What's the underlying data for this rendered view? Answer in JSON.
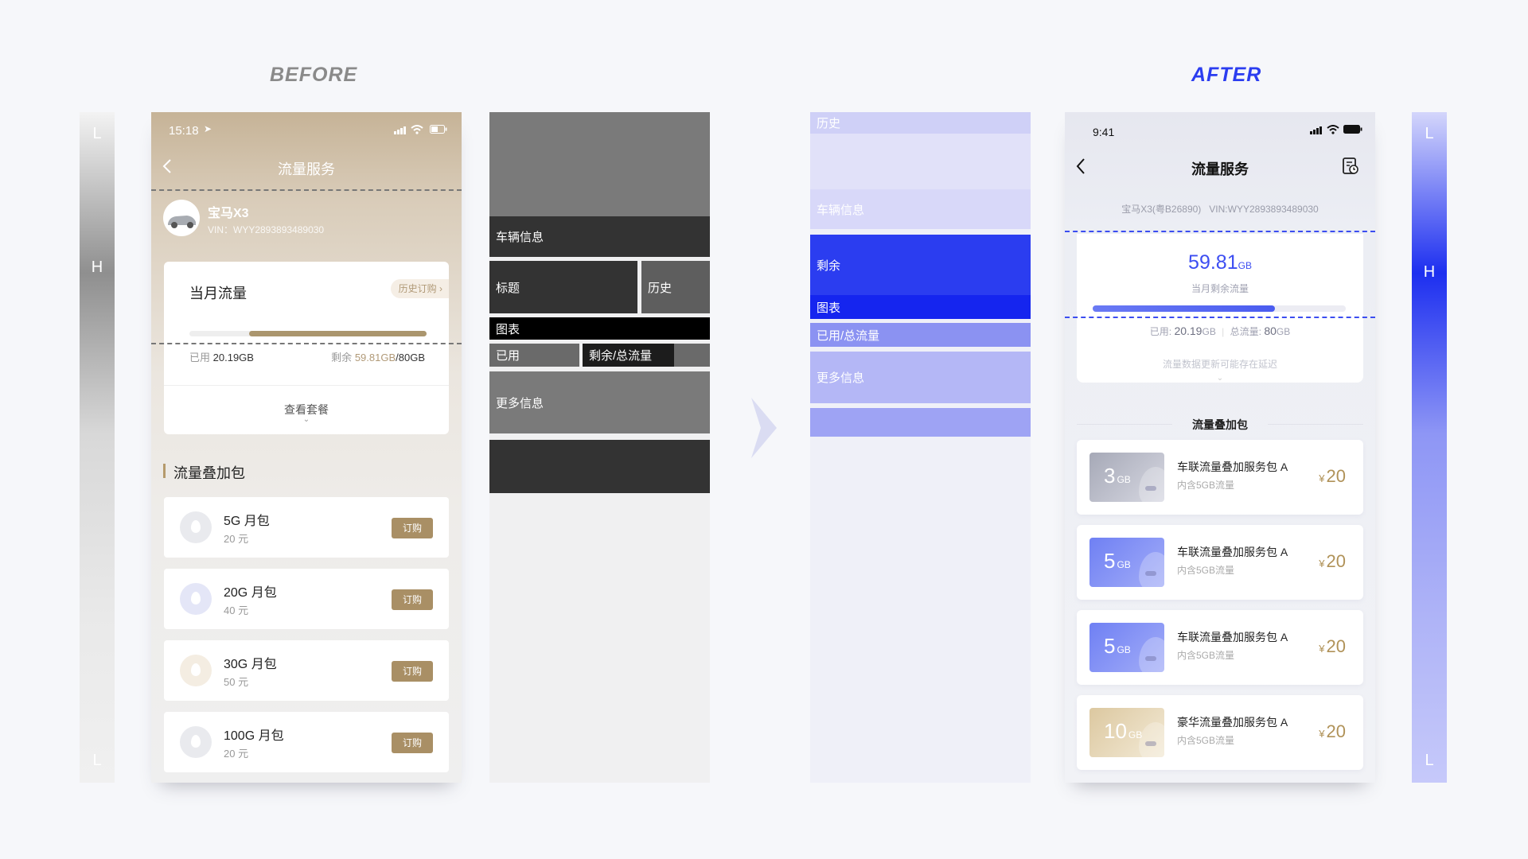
{
  "headings": {
    "before": "BEFORE",
    "after": "AFTER"
  },
  "bars": {
    "low": "L",
    "high": "H"
  },
  "before_phone": {
    "time": "15:18",
    "title": "流量服务",
    "car_name": "宝马X3",
    "vin": "VIN：WYY2893893489030",
    "card_title": "当月流量",
    "history_btn": "历史订购",
    "used_label": "已用",
    "used_value": "20.19GB",
    "remaining_label": "剩余",
    "remaining_value": "59.81GB",
    "total_value": "/80GB",
    "used_fraction": 0.25,
    "view_plans": "查看套餐",
    "section_title": "流量叠加包",
    "packages": [
      {
        "name": "5G 月包",
        "price": "20 元",
        "button": "订购"
      },
      {
        "name": "20G 月包",
        "price": "40 元",
        "button": "订购"
      },
      {
        "name": "30G 月包",
        "price": "50 元",
        "button": "订购"
      },
      {
        "name": "100G 月包",
        "price": "20 元",
        "button": "订购"
      }
    ]
  },
  "before_wireframe": {
    "vehicle": "车辆信息",
    "title": "标题",
    "history": "历史",
    "chart": "图表",
    "used": "已用",
    "remaining_total": "剩余/总流量",
    "more": "更多信息"
  },
  "after_wireframe": {
    "history": "历史",
    "vehicle": "车辆信息",
    "remaining": "剩余",
    "chart": "图表",
    "used_total": "已用/总流量",
    "more": "更多信息"
  },
  "after_phone": {
    "time": "9:41",
    "title": "流量服务",
    "vehicle_line": "宝马X3(粤B26890)   VIN:WYY2893893489030",
    "remaining_value": "59.81",
    "remaining_unit": "GB",
    "remaining_label": "当月剩余流量",
    "used_fraction": 0.72,
    "used_label": "已用:",
    "used_value": "20.19",
    "used_unit": "GB",
    "total_label": "总流量:",
    "total_value": "80",
    "total_unit": "GB",
    "notice": "流量数据更新可能存在延迟",
    "section_title": "流量叠加包",
    "packages": [
      {
        "size": "3",
        "unit": "GB",
        "name": "车联流量叠加服务包 A",
        "desc": "内含5GB流量",
        "currency": "¥",
        "price": "20"
      },
      {
        "size": "5",
        "unit": "GB",
        "name": "车联流量叠加服务包 A",
        "desc": "内含5GB流量",
        "currency": "¥",
        "price": "20"
      },
      {
        "size": "5",
        "unit": "GB",
        "name": "车联流量叠加服务包 A",
        "desc": "内含5GB流量",
        "currency": "¥",
        "price": "20"
      },
      {
        "size": "10",
        "unit": "GB",
        "name": "豪华流量叠加服务包 A",
        "desc": "内含5GB流量",
        "currency": "¥",
        "price": "20"
      }
    ]
  },
  "colors": {
    "gold": "#a98f65",
    "accent": "#2b3df0",
    "accent_light": "#dcdcf8"
  }
}
